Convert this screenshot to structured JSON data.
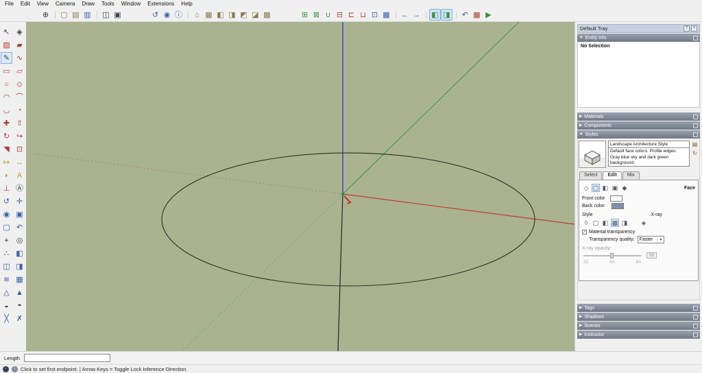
{
  "menu_bar": {
    "items": [
      "File",
      "Edit",
      "View",
      "Camera",
      "Draw",
      "Tools",
      "Window",
      "Extensions",
      "Help"
    ]
  },
  "toolbar": {
    "items": [
      {
        "name": "add-location-icon",
        "glyph": "⊕",
        "tone": "dark"
      },
      {
        "name": "new-icon",
        "glyph": "▢",
        "tone": "tan",
        "sep": true
      },
      {
        "name": "open-icon",
        "glyph": "▤",
        "tone": "tan"
      },
      {
        "name": "save-icon",
        "glyph": "▥",
        "tone": "blue"
      },
      {
        "name": "copy-icon",
        "glyph": "◫",
        "tone": "dark",
        "sep": true
      },
      {
        "name": "paste-icon",
        "glyph": "▣",
        "tone": "dark"
      },
      {
        "name": "orbit-icon",
        "glyph": "↺",
        "tone": "blue",
        "gap": true
      },
      {
        "name": "zoom-icon",
        "glyph": "◉",
        "tone": "blue"
      },
      {
        "name": "model-info-icon",
        "glyph": "ⓘ",
        "tone": "blue"
      },
      {
        "name": "view-iso-icon",
        "glyph": "⌂",
        "tone": "tan",
        "sep": true
      },
      {
        "name": "view-top-icon",
        "glyph": "▦",
        "tone": "tan"
      },
      {
        "name": "view-front-icon",
        "glyph": "◧",
        "tone": "tan"
      },
      {
        "name": "view-right-icon",
        "glyph": "◨",
        "tone": "tan"
      },
      {
        "name": "view-back-icon",
        "glyph": "◩",
        "tone": "tan"
      },
      {
        "name": "view-left-icon",
        "glyph": "◪",
        "tone": "tan"
      },
      {
        "name": "view-bottom-icon",
        "glyph": "▩",
        "tone": "tan"
      },
      {
        "name": "outer-shell-icon",
        "glyph": "⊞",
        "tone": "green",
        "gap": true
      },
      {
        "name": "intersect-icon",
        "glyph": "⊠",
        "tone": "green"
      },
      {
        "name": "union-icon",
        "glyph": "∪",
        "tone": "green"
      },
      {
        "name": "subtract-icon",
        "glyph": "⊟",
        "tone": "red"
      },
      {
        "name": "trim-icon",
        "glyph": "⊏",
        "tone": "red"
      },
      {
        "name": "split-icon",
        "glyph": "⊔",
        "tone": "red"
      },
      {
        "name": "section-plane-icon",
        "glyph": "⊡",
        "tone": "blue"
      },
      {
        "name": "section-fill-icon",
        "glyph": "▩",
        "tone": "blue"
      },
      {
        "name": "previous-view-icon",
        "glyph": "←",
        "tone": "blue",
        "sep": true
      },
      {
        "name": "next-view-icon",
        "glyph": "→",
        "tone": "blue"
      },
      {
        "name": "perspective-toggle-icon",
        "glyph": "◧",
        "tone": "green",
        "sel": true,
        "sep": true
      },
      {
        "name": "xray-toggle-icon",
        "glyph": "◨",
        "tone": "green",
        "sel": true
      },
      {
        "name": "undo-icon",
        "glyph": "↶",
        "tone": "blue",
        "sep": true
      },
      {
        "name": "generate-report-icon",
        "glyph": "▦",
        "tone": "red"
      },
      {
        "name": "run-extension-icon",
        "glyph": "▶",
        "tone": "green"
      }
    ]
  },
  "tool_palette": {
    "tools": [
      {
        "name": "select-tool",
        "glyph": "↖",
        "tone": "dark"
      },
      {
        "name": "make-component-tool",
        "glyph": "◈",
        "tone": "dark"
      },
      {
        "name": "paint-bucket-tool",
        "glyph": "▨",
        "tone": "red"
      },
      {
        "name": "eraser-tool",
        "glyph": "▰",
        "tone": "red"
      },
      {
        "name": "line-tool",
        "glyph": "✎",
        "tone": "dark",
        "sel": true
      },
      {
        "name": "freehand-tool",
        "glyph": "∿",
        "tone": "red"
      },
      {
        "name": "rectangle-tool",
        "glyph": "▭",
        "tone": "red"
      },
      {
        "name": "rotated-rectangle-tool",
        "glyph": "▱",
        "tone": "red"
      },
      {
        "name": "circle-tool",
        "glyph": "○",
        "tone": "red"
      },
      {
        "name": "polygon-tool",
        "glyph": "◇",
        "tone": "red"
      },
      {
        "name": "arc-tool",
        "glyph": "◠",
        "tone": "red"
      },
      {
        "name": "two-point-arc-tool",
        "glyph": "⌒",
        "tone": "red"
      },
      {
        "name": "three-point-arc-tool",
        "glyph": "◡",
        "tone": "red"
      },
      {
        "name": "pie-tool",
        "glyph": "◔",
        "tone": "red"
      },
      {
        "name": "move-tool",
        "glyph": "✚",
        "tone": "red"
      },
      {
        "name": "push-pull-tool",
        "glyph": "⇧",
        "tone": "red"
      },
      {
        "name": "rotate-tool",
        "glyph": "↻",
        "tone": "red"
      },
      {
        "name": "follow-me-tool",
        "glyph": "↪",
        "tone": "red"
      },
      {
        "name": "scale-tool",
        "glyph": "◥",
        "tone": "red"
      },
      {
        "name": "offset-tool",
        "glyph": "⊡",
        "tone": "red"
      },
      {
        "name": "tape-measure-tool",
        "glyph": "↦",
        "tone": "yellow"
      },
      {
        "name": "dimension-tool",
        "glyph": "↔",
        "tone": "yellow"
      },
      {
        "name": "protractor-tool",
        "glyph": "◗",
        "tone": "yellow"
      },
      {
        "name": "text-tool",
        "glyph": "A",
        "tone": "yellow"
      },
      {
        "name": "axes-tool",
        "glyph": "⊥",
        "tone": "red"
      },
      {
        "name": "3d-text-tool",
        "glyph": "Ⓐ",
        "tone": "dark"
      },
      {
        "name": "orbit-tool",
        "glyph": "↺",
        "tone": "blue"
      },
      {
        "name": "pan-tool",
        "glyph": "✛",
        "tone": "blue"
      },
      {
        "name": "zoom-tool",
        "glyph": "◉",
        "tone": "blue"
      },
      {
        "name": "zoom-window-tool",
        "glyph": "▣",
        "tone": "blue"
      },
      {
        "name": "zoom-extents-tool",
        "glyph": "▢",
        "tone": "blue"
      },
      {
        "name": "previous-view-tool",
        "glyph": "↶",
        "tone": "blue"
      },
      {
        "name": "position-camera-tool",
        "glyph": "⌖",
        "tone": "dark"
      },
      {
        "name": "look-around-tool",
        "glyph": "◎",
        "tone": "dark"
      },
      {
        "name": "walk-tool",
        "glyph": "∴",
        "tone": "dark"
      },
      {
        "name": "section-plane-tool",
        "glyph": "◧",
        "tone": "blue"
      },
      {
        "name": "section-display-toggle",
        "glyph": "◫",
        "tone": "blue"
      },
      {
        "name": "section-cut-toggle",
        "glyph": "◨",
        "tone": "blue"
      },
      {
        "name": "sandbox-from-contours-tool",
        "glyph": "≋",
        "tone": "blue"
      },
      {
        "name": "sandbox-from-scratch-tool",
        "glyph": "▦",
        "tone": "blue"
      },
      {
        "name": "smoove-tool",
        "glyph": "△",
        "tone": "blue"
      },
      {
        "name": "stamp-tool",
        "glyph": "▲",
        "tone": "blue"
      },
      {
        "name": "drape-tool",
        "glyph": "◒",
        "tone": "dark"
      },
      {
        "name": "add-detail-tool",
        "glyph": "◓",
        "tone": "dark"
      },
      {
        "name": "flip-edge-tool",
        "glyph": "╳",
        "tone": "blue"
      },
      {
        "name": "soften-edges-tool",
        "glyph": "✗",
        "tone": "blue"
      }
    ]
  },
  "canvas": {
    "background": "#a9b38f",
    "axis_blue": "#2a2ad0",
    "axis_blue_neg": "#20203a",
    "axis_green": "#4a9a4a",
    "axis_green_neg": "#6fa06f",
    "axis_red": "#c03a30",
    "axis_red_neg": "#ad7070",
    "edge_color": "#1e1e1e",
    "origin_color": "#2e8b57",
    "preview_color": "#cc2020"
  },
  "tray": {
    "title": "Default Tray",
    "help_glyph": "?",
    "close_glyph": "×",
    "sections": [
      {
        "label": "Entity Info",
        "arrow": "▼"
      },
      {
        "label": "Materials",
        "arrow": "▶"
      },
      {
        "label": "Components",
        "arrow": "▶"
      },
      {
        "label": "Styles",
        "arrow": "▼"
      },
      {
        "label": "Tags",
        "arrow": "▶"
      },
      {
        "label": "Shadows",
        "arrow": "▶"
      },
      {
        "label": "Scenes",
        "arrow": "▶"
      },
      {
        "label": "Instructor",
        "arrow": "▶"
      }
    ],
    "entity_info": {
      "message": "No Selection"
    },
    "styles_panel": {
      "style_name": "Landscape Architecture Style",
      "style_description": "Default face colors. Profile edges. Gray blue sky and dark green background.",
      "action_icons": [
        {
          "name": "create-new-style-button",
          "glyph": "▤"
        },
        {
          "name": "update-style-button",
          "glyph": "↻"
        }
      ],
      "tabs": [
        {
          "name": "tab-select",
          "label": "Select"
        },
        {
          "name": "tab-edit",
          "label": "Edit",
          "sel": true
        },
        {
          "name": "tab-mix",
          "label": "Mix"
        }
      ],
      "edit_icons": [
        {
          "name": "edge-settings-icon",
          "glyph": "◇"
        },
        {
          "name": "face-settings-icon",
          "glyph": "▢",
          "sel": true
        },
        {
          "name": "background-settings-icon",
          "glyph": "◧"
        },
        {
          "name": "watermark-settings-icon",
          "glyph": "▣"
        },
        {
          "name": "modeling-settings-icon",
          "glyph": "◆"
        }
      ],
      "face_label": "Face",
      "front_color_label": "Front color",
      "front_color_value": "#ffffff",
      "back_color_label": "Back color",
      "back_color_value": "#7e93ab",
      "style_label": "Style",
      "xray_label": "X-ray",
      "face_style_icons": [
        {
          "name": "wireframe-style-icon",
          "glyph": "◊"
        },
        {
          "name": "hidden-line-style-icon",
          "glyph": "▢"
        },
        {
          "name": "shaded-style-icon",
          "glyph": "◧"
        },
        {
          "name": "shaded-with-textures-style-icon",
          "glyph": "▩",
          "sel": true
        },
        {
          "name": "monochrome-style-icon",
          "glyph": "◨"
        }
      ],
      "xray_icon_glyph": "◈",
      "material_transparency_label": "Material transparency",
      "material_transparency_checked": "✓",
      "transparency_quality_label": "Transparency quality:",
      "transparency_quality_value": "Faster",
      "dropdown_caret": "▼",
      "xray_opacity_label": "X-ray opacity:",
      "xray_opacity_ticks": [
        {
          "v": "20"
        },
        {
          "v": "50"
        },
        {
          "v": "80"
        }
      ],
      "xray_opacity_value": "50"
    }
  },
  "measurement_bar": {
    "label": "Length",
    "value": ""
  },
  "status_bar": {
    "geo_glyph": "◦",
    "info_glyph": "i",
    "text": "Click to set first endpoint. | Arrow Keys = Toggle Lock Inference Direction."
  }
}
